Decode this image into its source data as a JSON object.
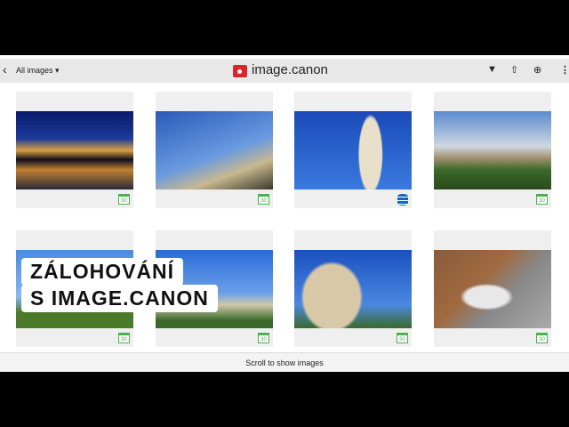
{
  "header": {
    "back_icon": "chevron-left-icon",
    "album": "All images ▾",
    "app_name": "image.canon",
    "icons": [
      "filter-icon",
      "share-icon",
      "add-icon",
      "more-icon"
    ]
  },
  "cards": [
    {
      "badge": "30"
    },
    {
      "badge": "30"
    },
    {
      "badge": "database"
    },
    {
      "badge": "30"
    },
    {
      "badge": "30"
    },
    {
      "badge": "30"
    },
    {
      "badge": "30"
    },
    {
      "badge": "30"
    }
  ],
  "overlay": {
    "line1": "ZÁLOHOVÁNÍ",
    "line2": "S IMAGE.CANON"
  },
  "footer": {
    "scroll_text": "Scroll to show images"
  }
}
